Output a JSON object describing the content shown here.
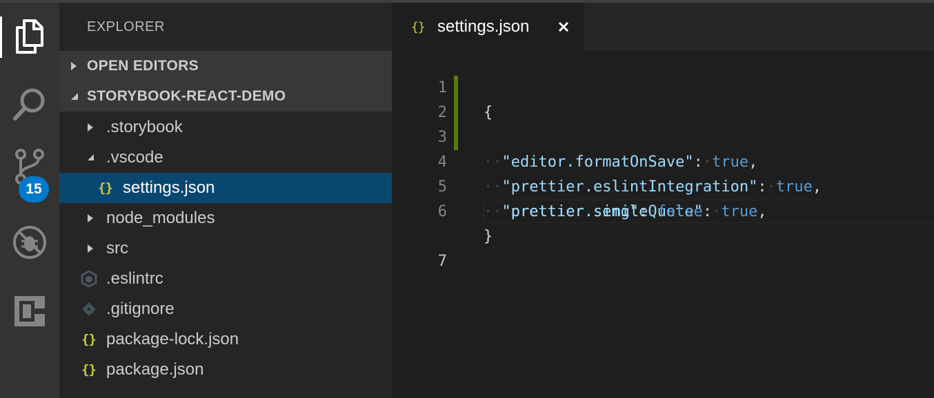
{
  "activity_bar": {
    "items": [
      {
        "icon": "files-icon",
        "active": true
      },
      {
        "icon": "search-icon",
        "active": false
      },
      {
        "icon": "source-control-icon",
        "active": false
      },
      {
        "icon": "debug-icon",
        "active": false
      },
      {
        "icon": "extensions-icon",
        "active": false
      }
    ],
    "scm_badge": "15"
  },
  "sidebar": {
    "title": "EXPLORER",
    "sections": [
      {
        "label": "OPEN EDITORS",
        "expanded": false
      },
      {
        "label": "STORYBOOK-REACT-DEMO",
        "expanded": true
      }
    ],
    "tree": [
      {
        "label": ".storybook",
        "type": "folder",
        "expanded": false
      },
      {
        "label": ".vscode",
        "type": "folder",
        "expanded": true
      },
      {
        "label": "settings.json",
        "type": "json",
        "selected": true
      },
      {
        "label": "node_modules",
        "type": "folder",
        "expanded": false
      },
      {
        "label": "src",
        "type": "folder",
        "expanded": false
      },
      {
        "label": ".eslintrc",
        "type": "eslint"
      },
      {
        "label": ".gitignore",
        "type": "git"
      },
      {
        "label": "package-lock.json",
        "type": "json"
      },
      {
        "label": "package.json",
        "type": "json"
      }
    ],
    "json_icon_glyph": "{}"
  },
  "editor": {
    "tab": {
      "label": "settings.json",
      "icon_glyph": "{}",
      "close_glyph": "×"
    },
    "lines": [
      {
        "num": "1",
        "text": "{"
      },
      {
        "num": "2",
        "key": "\"editor.formatOnSave\"",
        "value": "true",
        "comma": ","
      },
      {
        "num": "3",
        "key": "\"prettier.eslintIntegration\"",
        "value": "true",
        "comma": ","
      },
      {
        "num": "4",
        "key": "\"prettier.singleQuote\"",
        "value": "true",
        "comma": ","
      },
      {
        "num": "5",
        "key": "\"prettier.semi\"",
        "value": "false",
        "comma": ""
      },
      {
        "num": "6",
        "text": "}"
      },
      {
        "num": "7",
        "text": ""
      }
    ]
  },
  "colors": {
    "activity_bar": "#333333",
    "sidebar": "#252526",
    "editor": "#1e1e1e",
    "selection": "#094771",
    "accent": "#007acc",
    "json_key": "#9cdcfe",
    "json_literal": "#569cd6",
    "gutter_modified": "#587c0c",
    "json_icon": "#cbcb41"
  }
}
